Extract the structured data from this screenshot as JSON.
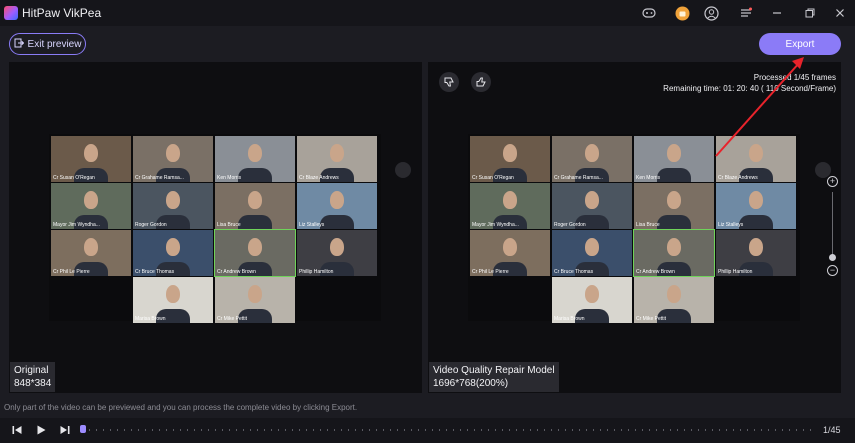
{
  "app": {
    "title": "HitPaw VikPea"
  },
  "titlebar": {
    "icons": [
      "gamepad-icon",
      "shop-icon",
      "account-icon",
      "menu-icon",
      "minimize-icon",
      "restore-icon",
      "close-icon"
    ]
  },
  "toolbar": {
    "exit_preview_label": "Exit preview",
    "export_label": "Export"
  },
  "original": {
    "label": "Original",
    "resolution": "848*384"
  },
  "repaired": {
    "label": "Video Quality Repair Model",
    "resolution": "1696*768(200%)"
  },
  "processing": {
    "processed": "Processed 1/45 frames",
    "remaining": "Remaining time: 01: 20: 40 ( 110 Second/Frame)"
  },
  "participants": [
    "Cr Susan O'Regan",
    "Cr Grahame Ramsa...",
    "Ken Morris",
    "Cr Blaze Andrews",
    "Mayor Jim Wyndha...",
    "Roger Gordon",
    "Lisa Bruce",
    "Liz Stalleys",
    "Cr Phil Le Pierre",
    "Cr Bruce Thomas",
    "Cr Andrew Brown",
    "Phillip Hamilton",
    "Marisa Brown",
    "Cr Mike Pettit"
  ],
  "footer": {
    "hint": "Only part of the video can be previewed and you can process the complete video by clicking Export.",
    "frame_count": "1/45"
  },
  "colors": {
    "accent": "#8b7bf7",
    "annotation_arrow": "#e8232b",
    "highlight_tile": "#6fd35a"
  }
}
